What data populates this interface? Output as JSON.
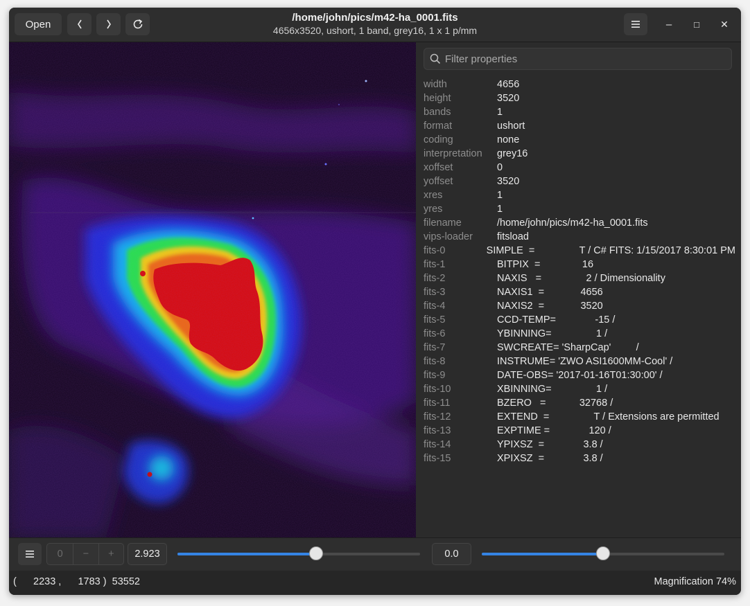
{
  "header": {
    "open_label": "Open",
    "back_icon": "chevron-left-icon",
    "forward_icon": "chevron-right-icon",
    "reload_icon": "reload-icon",
    "title": "/home/john/pics/m42-ha_0001.fits",
    "subtitle": "4656x3520, ushort, 1 band, grey16, 1 x 1 p/mm",
    "menu_icon": "hamburger-menu-icon",
    "minimize_glyph": "–",
    "maximize_glyph": "□",
    "close_glyph": "✕"
  },
  "properties": {
    "filter_placeholder": "Filter properties",
    "rows": [
      {
        "name": "width",
        "value": "4656"
      },
      {
        "name": "height",
        "value": "3520"
      },
      {
        "name": "bands",
        "value": "1"
      },
      {
        "name": "format",
        "value": "ushort"
      },
      {
        "name": "coding",
        "value": "none"
      },
      {
        "name": "interpretation",
        "value": "grey16"
      },
      {
        "name": "xoffset",
        "value": "0"
      },
      {
        "name": "yoffset",
        "value": "3520"
      },
      {
        "name": "xres",
        "value": "1"
      },
      {
        "name": "yres",
        "value": "1"
      },
      {
        "name": "filename",
        "value": "/home/john/pics/m42-ha_0001.fits"
      },
      {
        "name": "vips-loader",
        "value": "fitsload"
      },
      {
        "name": "fits-0",
        "value": "SIMPLE  =                T / C# FITS: 1/15/2017 8:30:01 PM"
      },
      {
        "name": "fits-1",
        "value": "BITPIX  =               16"
      },
      {
        "name": "fits-2",
        "value": "NAXIS   =                2 / Dimensionality"
      },
      {
        "name": "fits-3",
        "value": "NAXIS1  =             4656"
      },
      {
        "name": "fits-4",
        "value": "NAXIS2  =             3520"
      },
      {
        "name": "fits-5",
        "value": "CCD-TEMP=              -15 /"
      },
      {
        "name": "fits-6",
        "value": "YBINNING=                1 /"
      },
      {
        "name": "fits-7",
        "value": "SWCREATE= 'SharpCap'         /"
      },
      {
        "name": "fits-8",
        "value": "INSTRUME= 'ZWO ASI1600MM-Cool' /"
      },
      {
        "name": "fits-9",
        "value": "DATE-OBS= '2017-01-16T01:30:00' /"
      },
      {
        "name": "fits-10",
        "value": "XBINNING=                1 /"
      },
      {
        "name": "fits-11",
        "value": "BZERO   =            32768 /"
      },
      {
        "name": "fits-12",
        "value": "EXTEND  =                T / Extensions are permitted"
      },
      {
        "name": "fits-13",
        "value": "EXPTIME =              120 /"
      },
      {
        "name": "fits-14",
        "value": "YPIXSZ  =              3.8 /"
      },
      {
        "name": "fits-15",
        "value": "XPIXSZ  =              3.8 /"
      }
    ]
  },
  "toolbar": {
    "menu_icon": "hamburger-menu-icon",
    "page_value": "0",
    "minus_glyph": "−",
    "plus_glyph": "+",
    "scale_value": "2.923",
    "scale_slider_fraction": 0.57,
    "offset_value": "0.0",
    "offset_slider_fraction": 0.5,
    "accent_color": "#3584e4"
  },
  "status": {
    "coords": "(      2233 ,      1783 )  53552",
    "magnification": "Magnification 74%"
  }
}
